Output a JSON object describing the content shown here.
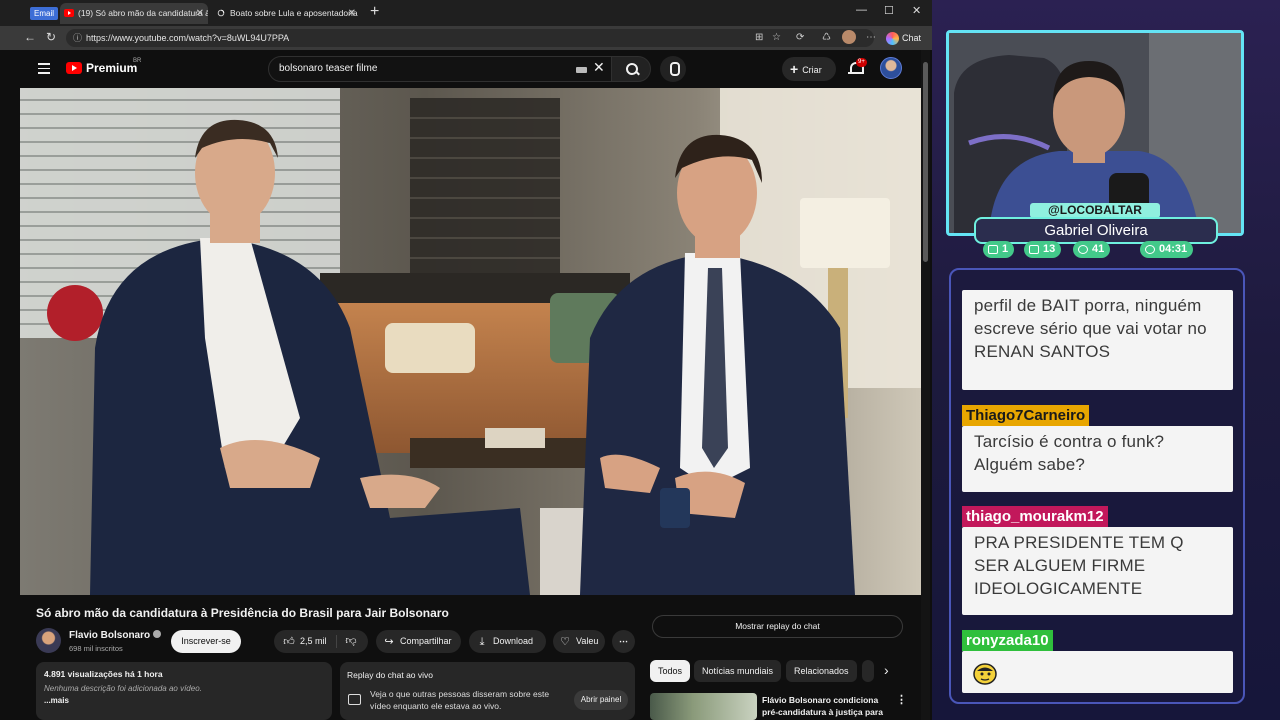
{
  "browser": {
    "email_badge": "Email",
    "tabs": [
      {
        "title": "(19) Só abro mão da candidatura à",
        "close": "✕"
      },
      {
        "title": "Boato sobre Lula e aposentadoria",
        "close": "✕"
      }
    ],
    "new_tab": "+",
    "window_controls": {
      "minimize": "—",
      "maximize": "☐",
      "close": "✕"
    },
    "url": "https://www.youtube.com/watch?v=8uWL94U7PPA",
    "chat_button": "Chat",
    "colors": {
      "tab_bar": "#1f1f1f",
      "address_bar": "#3a3a3a"
    }
  },
  "youtube": {
    "brand": "Premium",
    "region": "BR",
    "search_query": "bolsonaro teaser filme",
    "create_label": "Criar",
    "notifications_badge": "9+",
    "video_title": "Só abro mão da candidatura à Presidência do Brasil para Jair Bolsonaro",
    "channel": {
      "name": "Flavio Bolsonaro",
      "subscribers": "698 mil inscritos"
    },
    "subscribe_label": "Inscrever-se",
    "likes": "2,5 mil",
    "actions": {
      "share": "Compartilhar",
      "download": "Download",
      "thanks": "Valeu",
      "more": "⋯"
    },
    "description": {
      "meta": "4.891 visualizações  há 1 hora",
      "empty": "Nenhuma descrição foi adicionada ao vídeo.",
      "more": "...mais"
    },
    "chat_replay": {
      "title": "Replay do chat ao vivo",
      "body": "Veja o que outras pessoas disseram sobre este vídeo enquanto ele estava ao vivo.",
      "open_label": "Abrir painel"
    },
    "show_chat_replay": "Mostrar replay do chat",
    "chips": [
      "Todos",
      "Notícias mundiais",
      "Relacionados"
    ],
    "recommended_title": "Flávio Bolsonaro condiciona pré-candidatura à justiça para ...",
    "colors": {
      "brand_red": "#ff0000",
      "background": "#0f0f0f"
    }
  },
  "stream": {
    "handle": "@LOCOBALTAR",
    "name": "Gabriel Oliveira",
    "stats": [
      {
        "icon": "chat-icon",
        "value": "1"
      },
      {
        "icon": "video-icon",
        "value": "13"
      },
      {
        "icon": "eye-icon",
        "value": "41"
      },
      {
        "icon": "clock-icon",
        "value": "04:31"
      }
    ],
    "colors": {
      "frame": "#64e4f5",
      "stats": "#43c98a"
    }
  },
  "chat": {
    "messages": [
      {
        "user": "",
        "text": "perfil de BAIT porra, ninguém escreve sério que vai votar no RENAN SANTOS"
      },
      {
        "user": "Thiago7Carneiro",
        "text": "Tarcísio é contra o funk? Alguém sabe?",
        "color": "#e8a600"
      },
      {
        "user": "thiago_mourakm12",
        "text": "PRA PRESIDENTE TEM Q SER ALGUEM FIRME IDEOLOGICAMENTE",
        "color": "#c2185b"
      },
      {
        "user": "ronyzada10",
        "text": "",
        "color": "#2fbf3c",
        "emote": "emote-icon"
      }
    ]
  }
}
